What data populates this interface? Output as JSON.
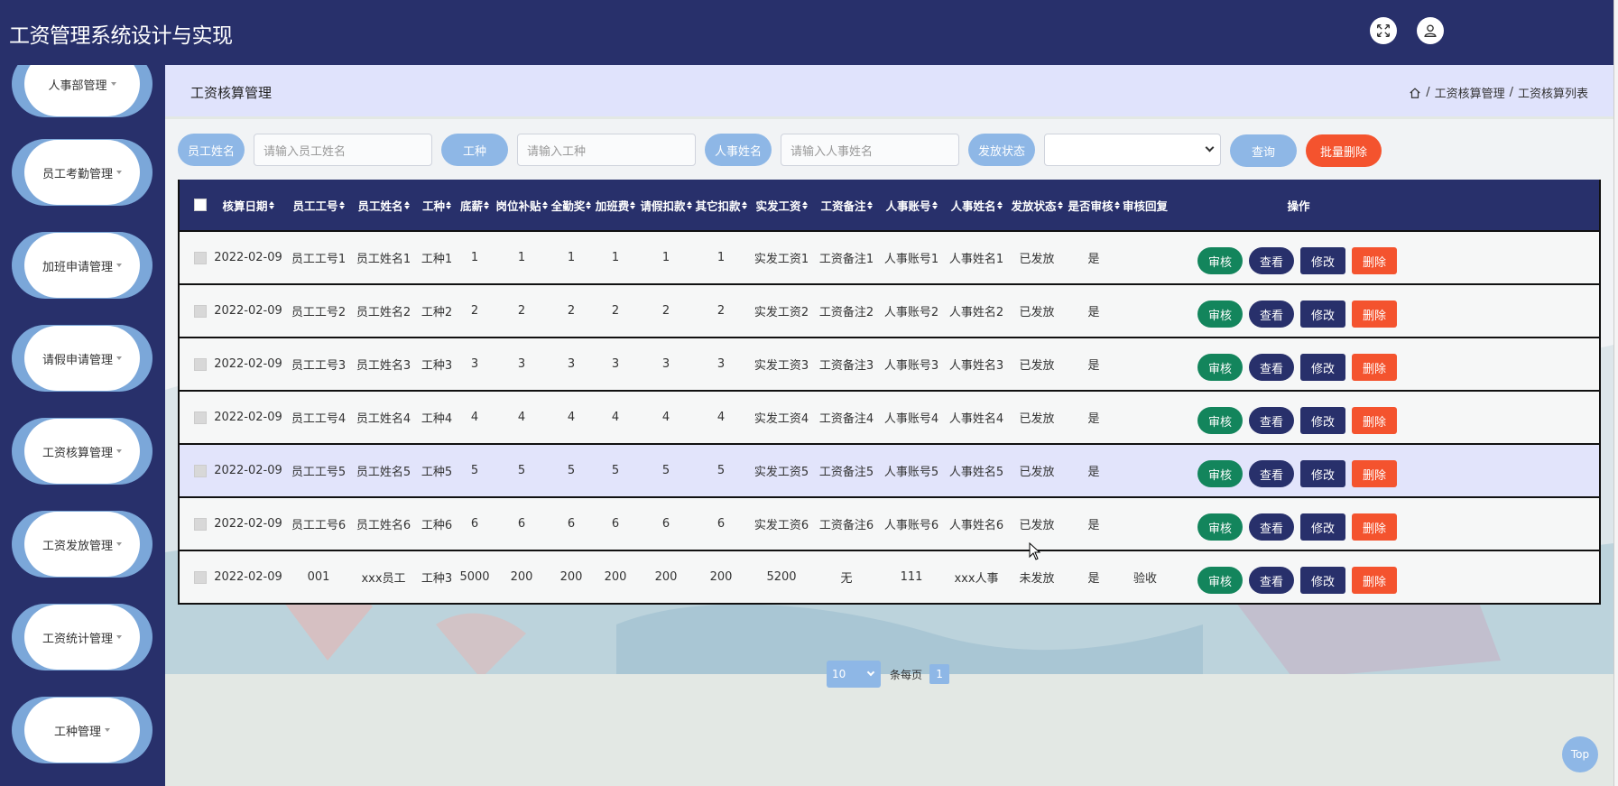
{
  "app": {
    "title": "工资管理系统设计与实现",
    "header_icons": [
      "fullscreen-icon",
      "user-icon"
    ]
  },
  "sidebar": {
    "items": [
      {
        "label": "人事部管理"
      },
      {
        "label": "员工考勤管理"
      },
      {
        "label": "加班申请管理"
      },
      {
        "label": "请假申请管理"
      },
      {
        "label": "工资核算管理"
      },
      {
        "label": "工资发放管理"
      },
      {
        "label": "工资统计管理"
      },
      {
        "label": "工种管理"
      }
    ]
  },
  "page": {
    "title": "工资核算管理",
    "breadcrumb": [
      "工资核算管理",
      "工资核算列表"
    ]
  },
  "search": {
    "name_label": "员工姓名",
    "name_placeholder": "请输入员工姓名",
    "type_label": "工种",
    "type_placeholder": "请输入工种",
    "hr_label": "人事姓名",
    "hr_placeholder": "请输入人事姓名",
    "status_label": "发放状态",
    "status_value": "",
    "query_label": "查询",
    "bulk_delete_label": "批量删除"
  },
  "table": {
    "columns": [
      "核算日期",
      "员工工号",
      "员工姓名",
      "工种",
      "底薪",
      "岗位补贴",
      "全勤奖",
      "加班费",
      "请假扣款",
      "其它扣款",
      "实发工资",
      "工资备注",
      "人事账号",
      "人事姓名",
      "发放状态",
      "是否审核",
      "审核回复",
      "操作"
    ],
    "actions": {
      "audit": "审核",
      "view": "查看",
      "edit": "修改",
      "delete": "删除"
    },
    "rows": [
      [
        "2022-02-09",
        "员工工号1",
        "员工姓名1",
        "工种1",
        "1",
        "1",
        "1",
        "1",
        "1",
        "1",
        "实发工资1",
        "工资备注1",
        "人事账号1",
        "人事姓名1",
        "已发放",
        "是",
        ""
      ],
      [
        "2022-02-09",
        "员工工号2",
        "员工姓名2",
        "工种2",
        "2",
        "2",
        "2",
        "2",
        "2",
        "2",
        "实发工资2",
        "工资备注2",
        "人事账号2",
        "人事姓名2",
        "已发放",
        "是",
        ""
      ],
      [
        "2022-02-09",
        "员工工号3",
        "员工姓名3",
        "工种3",
        "3",
        "3",
        "3",
        "3",
        "3",
        "3",
        "实发工资3",
        "工资备注3",
        "人事账号3",
        "人事姓名3",
        "已发放",
        "是",
        ""
      ],
      [
        "2022-02-09",
        "员工工号4",
        "员工姓名4",
        "工种4",
        "4",
        "4",
        "4",
        "4",
        "4",
        "4",
        "实发工资4",
        "工资备注4",
        "人事账号4",
        "人事姓名4",
        "已发放",
        "是",
        ""
      ],
      [
        "2022-02-09",
        "员工工号5",
        "员工姓名5",
        "工种5",
        "5",
        "5",
        "5",
        "5",
        "5",
        "5",
        "实发工资5",
        "工资备注5",
        "人事账号5",
        "人事姓名5",
        "已发放",
        "是",
        ""
      ],
      [
        "2022-02-09",
        "员工工号6",
        "员工姓名6",
        "工种6",
        "6",
        "6",
        "6",
        "6",
        "6",
        "6",
        "实发工资6",
        "工资备注6",
        "人事账号6",
        "人事姓名6",
        "已发放",
        "是",
        ""
      ],
      [
        "2022-02-09",
        "001",
        "xxx员工",
        "工种3",
        "5000",
        "200",
        "200",
        "200",
        "200",
        "200",
        "5200",
        "无",
        "111",
        "xxx人事",
        "未发放",
        "是",
        "验收"
      ]
    ]
  },
  "pager": {
    "page_size": "10",
    "per_page_text": "条每页",
    "current_page": "1"
  },
  "top_button": "Top",
  "colors": {
    "header_bg": "#28306b",
    "accent_light": "#8eb7e6",
    "audit_green": "#13855c",
    "delete_red": "#f4532e",
    "crumb_bg": "#e0e3fc"
  }
}
